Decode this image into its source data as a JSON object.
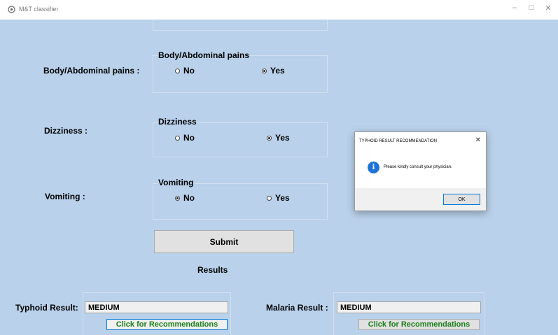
{
  "window": {
    "title": "M&T classifier",
    "minimize": "–",
    "maximize": "□",
    "close": "✕"
  },
  "form": {
    "body_pains": {
      "label": "Body/Abdominal pains :",
      "group_title": "Body/Abdominal pains",
      "no": "No",
      "yes": "Yes",
      "selected": "Yes"
    },
    "dizziness": {
      "label": "Dizziness :",
      "group_title": "Dizziness",
      "no": "No",
      "yes": "Yes",
      "selected": "Yes"
    },
    "vomiting": {
      "label": "Vomiting :",
      "group_title": "Vomiting",
      "no": "No",
      "yes": "Yes",
      "selected": "No"
    },
    "submit_label": "Submit",
    "results_label": "Results"
  },
  "results": {
    "typhoid": {
      "label": "Typhoid Result:",
      "value": "MEDIUM",
      "button": "Click for Recommendations"
    },
    "malaria": {
      "label": "Malaria Result :",
      "value": "MEDIUM",
      "button": "Click for Recommendations"
    }
  },
  "dialog": {
    "title": "TYPHOID RESULT RECOMMENDATION",
    "close": "✕",
    "icon": "info-icon",
    "message": "Please kindly consult your physician.",
    "ok": "OK"
  }
}
